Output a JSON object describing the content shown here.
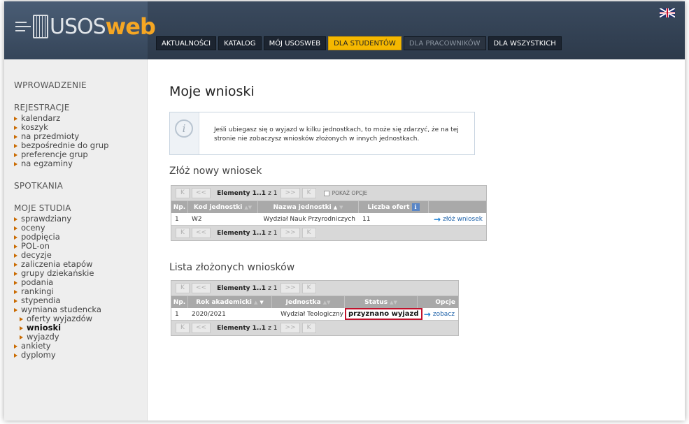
{
  "header": {
    "logo_us": "USOS",
    "logo_web": "web",
    "nav": [
      {
        "label": "AKTUALNOŚCI",
        "state": "normal"
      },
      {
        "label": "KATALOG",
        "state": "normal"
      },
      {
        "label": "MÓJ USOSWEB",
        "state": "normal"
      },
      {
        "label": "DLA STUDENTÓW",
        "state": "active"
      },
      {
        "label": "DLA PRACOWNIKÓW",
        "state": "muted"
      },
      {
        "label": "DLA WSZYSTKICH",
        "state": "normal"
      }
    ]
  },
  "sidebar": {
    "sections": [
      {
        "title": "WPROWADZENIE",
        "items": []
      },
      {
        "title": "REJESTRACJE",
        "items": [
          "kalendarz",
          "koszyk",
          "na przedmioty",
          "bezpośrednie do grup",
          "preferencje grup",
          "na egzaminy"
        ]
      },
      {
        "title": "SPOTKANIA",
        "items": []
      },
      {
        "title": "MOJE STUDIA",
        "items": [
          "sprawdziany",
          "oceny",
          "podpięcia",
          "POL-on",
          "decyzje",
          "zaliczenia etapów",
          "grupy dziekańskie",
          "podania",
          "rankingi",
          "stypendia",
          "wymiana studencka"
        ]
      }
    ],
    "sub_items": [
      "oferty wyjazdów",
      "wnioski",
      "wyjazdy"
    ],
    "after_items": [
      "ankiety",
      "dyplomy"
    ]
  },
  "main": {
    "title": "Moje wnioski",
    "info_text": "Jeśli ubiegasz się o wyjazd w kilku jednostkach, to może się zdarzyć, że na tej stronie nie zobaczysz wniosków złożonych w innych jednostkach.",
    "new_section_title": "Złóż nowy wniosek",
    "list_section_title": "Lista złożonych wniosków",
    "pager": {
      "first": "K",
      "prev": "<<",
      "next": ">>",
      "last": "K",
      "label": "Elementy",
      "range": "1..1",
      "of": "z 1",
      "show_options": "POKAŻ OPCJE"
    },
    "new_table": {
      "headers": [
        "Np.",
        "Kod jednostki",
        "Nazwa jednostki",
        "Liczba ofert"
      ],
      "row": {
        "np": "1",
        "code": "W2",
        "name": "Wydział Nauk Przyrodniczych",
        "offers": "11",
        "action": "złóż wniosek"
      }
    },
    "list_table": {
      "headers": [
        "Np.",
        "Rok akademicki",
        "Jednostka",
        "Status",
        "Opcje"
      ],
      "row": {
        "np": "1",
        "year": "2020/2021",
        "unit": "Wydział Teologiczny",
        "status": "przyznano wyjazd",
        "action": "zobacz"
      }
    }
  },
  "colors": {
    "active_tab": "#f5b800",
    "status_highlight": "#c0122c",
    "link": "#1a5fa8"
  }
}
